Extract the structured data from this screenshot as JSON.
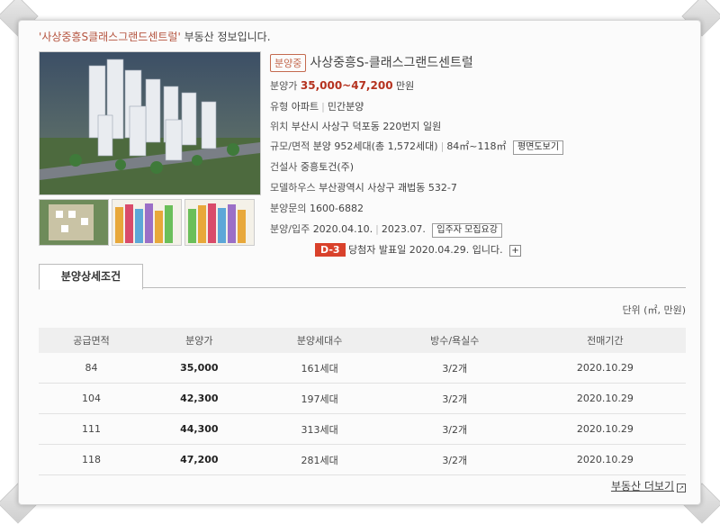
{
  "intro": {
    "quote_open": "'",
    "name": "사상중흥S클래스그랜드센트럴",
    "quote_close": "'",
    "suffix": " 부동산 정보입니다."
  },
  "listing": {
    "status_badge": "분양중",
    "title": "사상중흥S-클래스그랜드센트럴",
    "price_label": "분양가",
    "price_value": "35,000~47,200",
    "price_unit": "만원",
    "type_label": "유형",
    "type_value": "아파트",
    "type_value2": "민간분양",
    "location_label": "위치",
    "location_value": "부산시 사상구 덕포동 220번지 일원",
    "scale_label": "규모/면적",
    "scale_value": "분양 952세대(총 1,572세대)",
    "area_value": "84㎡~118㎡",
    "floorplan_button": "평면도보기",
    "builder_label": "건설사",
    "builder_value": "중흥토건(주)",
    "modelhouse_label": "모델하우스",
    "modelhouse_value": "부산광역시 사상구 괘법동 532-7",
    "inquiry_label": "분양문의",
    "inquiry_value": "1600-6882",
    "dates_label": "분양/입주",
    "sale_date": "2020.04.10.",
    "move_in_date": "2023.07.",
    "notice_button": "입주자 모집요강",
    "dday": "D-3",
    "winner_text": "당첨자 발표일 2020.04.29. 입니다.",
    "plus_icon": "+"
  },
  "tabs": [
    {
      "label": "분양상세조건"
    }
  ],
  "unit_note": "단위 (㎡, 만원)",
  "table": {
    "headers": [
      "공급면적",
      "분양가",
      "분양세대수",
      "방수/욕실수",
      "전매기간"
    ],
    "rows": [
      [
        "84",
        "35,000",
        "161세대",
        "3/2개",
        "2020.10.29"
      ],
      [
        "104",
        "42,300",
        "197세대",
        "3/2개",
        "2020.10.29"
      ],
      [
        "111",
        "44,300",
        "313세대",
        "3/2개",
        "2020.10.29"
      ],
      [
        "118",
        "47,200",
        "281세대",
        "3/2개",
        "2020.10.29"
      ]
    ]
  },
  "more_link": "부동산 더보기"
}
